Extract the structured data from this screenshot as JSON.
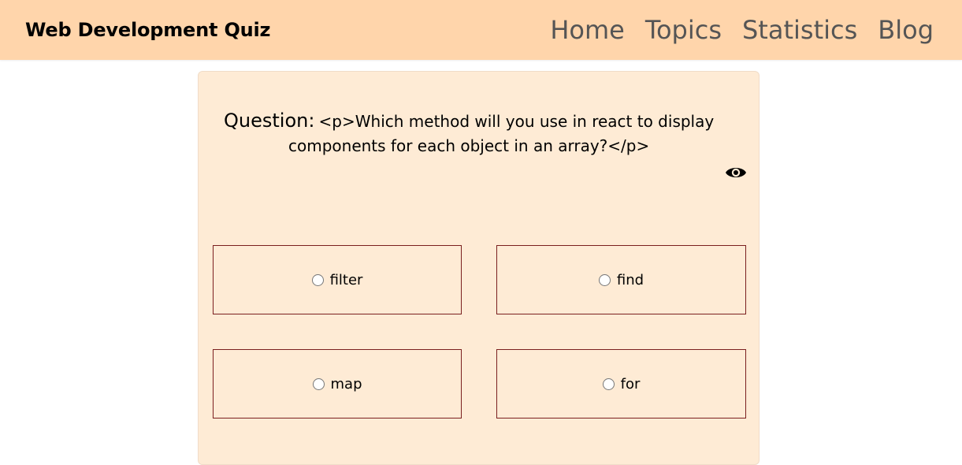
{
  "navbar": {
    "brand": "Web Development Quiz",
    "links": [
      {
        "label": "Home"
      },
      {
        "label": "Topics"
      },
      {
        "label": "Statistics"
      },
      {
        "label": "Blog"
      }
    ],
    "background": "#ffd5ab"
  },
  "quiz": {
    "question_label": "Question:",
    "question_line1": "<p>Which method will you use in react to display",
    "question_line2": "components for each object in an array?</p>",
    "reveal_icon": "eye-icon",
    "card_background": "#feebd5",
    "option_border": "#7a1f1f",
    "options": [
      {
        "label": "filter",
        "selected": false
      },
      {
        "label": "find",
        "selected": false
      },
      {
        "label": "map",
        "selected": false
      },
      {
        "label": "for",
        "selected": false
      }
    ]
  }
}
